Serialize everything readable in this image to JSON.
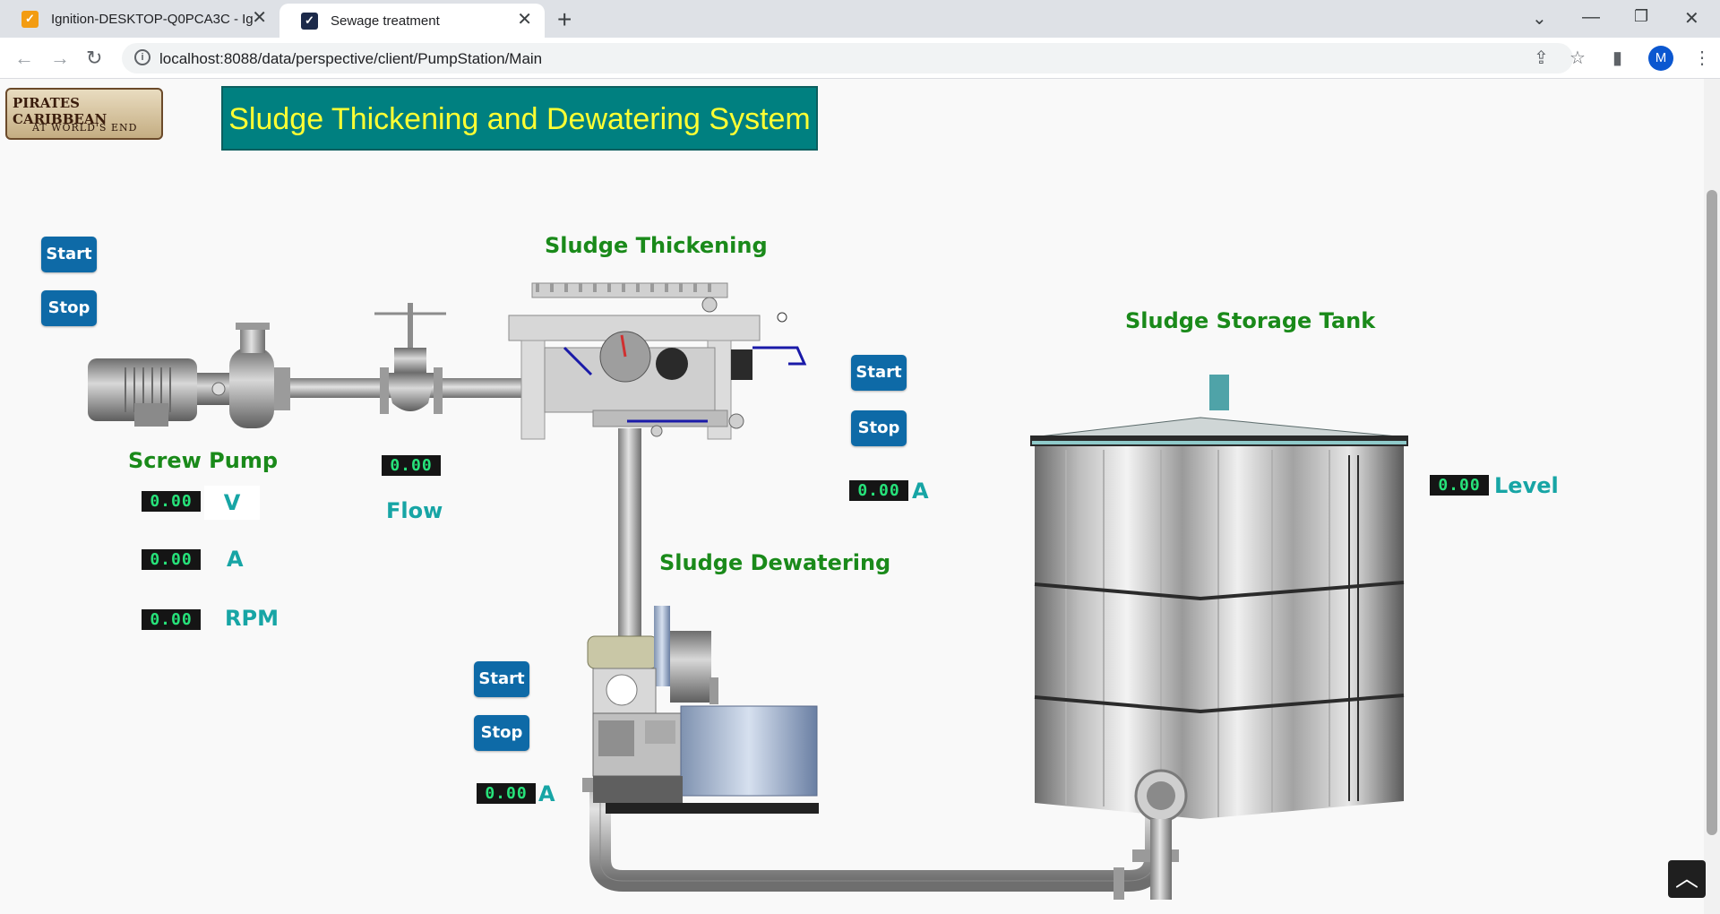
{
  "browser": {
    "tabs": [
      {
        "title": "Ignition-DESKTOP-Q0PCA3C - Ig"
      },
      {
        "title": "Sewage treatment"
      }
    ],
    "url": "localhost:8088/data/perspective/client/PumpStation/Main",
    "profile_initial": "M"
  },
  "header": {
    "logo_line1": "PIRATES CARIBBEAN",
    "logo_line2": "AT WORLD'S END",
    "title": "Sludge Thickening and Dewatering System",
    "title_bg": "#008080",
    "title_color": "#ffff33"
  },
  "screw_pump": {
    "label": "Screw Pump",
    "start_label": "Start",
    "stop_label": "Stop",
    "voltage_value": "0.00",
    "voltage_unit": "V",
    "current_value": "0.00",
    "current_unit": "A",
    "rpm_value": "0.00",
    "rpm_unit": "RPM"
  },
  "flow": {
    "label": "Flow",
    "value": "0.00"
  },
  "thickening": {
    "label": "Sludge Thickening",
    "start_label": "Start",
    "stop_label": "Stop",
    "current_value": "0.00",
    "current_unit": "A"
  },
  "dewatering": {
    "label": "Sludge Dewatering",
    "start_label": "Start",
    "stop_label": "Stop",
    "current_value": "0.00",
    "current_unit": "A"
  },
  "storage_tank": {
    "label": "Sludge Storage Tank",
    "level_value": "0.00",
    "level_label": "Level"
  },
  "colors": {
    "button": "#0e6aa7",
    "equipment_label": "#1a8a1a",
    "unit_label": "#17a5a5",
    "led_digits": "#27e27a"
  }
}
